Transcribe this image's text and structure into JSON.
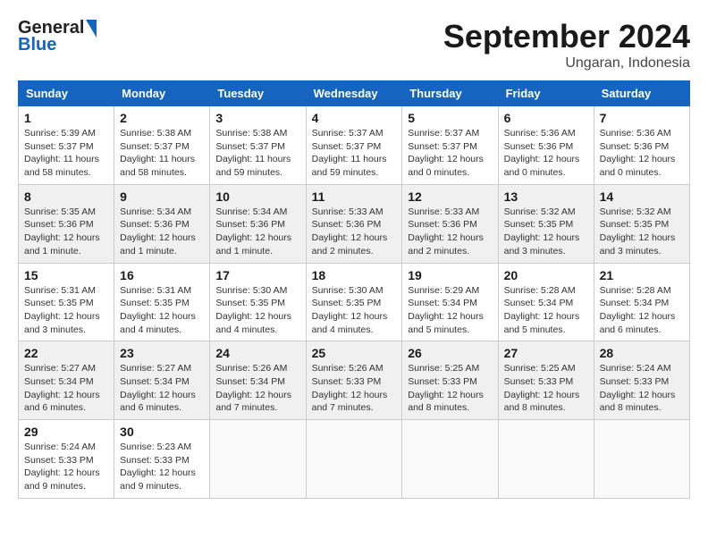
{
  "header": {
    "logo_general": "General",
    "logo_blue": "Blue",
    "month": "September 2024",
    "location": "Ungaran, Indonesia"
  },
  "days_of_week": [
    "Sunday",
    "Monday",
    "Tuesday",
    "Wednesday",
    "Thursday",
    "Friday",
    "Saturday"
  ],
  "weeks": [
    [
      {
        "day": "1",
        "info": "Sunrise: 5:39 AM\nSunset: 5:37 PM\nDaylight: 11 hours\nand 58 minutes."
      },
      {
        "day": "2",
        "info": "Sunrise: 5:38 AM\nSunset: 5:37 PM\nDaylight: 11 hours\nand 58 minutes."
      },
      {
        "day": "3",
        "info": "Sunrise: 5:38 AM\nSunset: 5:37 PM\nDaylight: 11 hours\nand 59 minutes."
      },
      {
        "day": "4",
        "info": "Sunrise: 5:37 AM\nSunset: 5:37 PM\nDaylight: 11 hours\nand 59 minutes."
      },
      {
        "day": "5",
        "info": "Sunrise: 5:37 AM\nSunset: 5:37 PM\nDaylight: 12 hours\nand 0 minutes."
      },
      {
        "day": "6",
        "info": "Sunrise: 5:36 AM\nSunset: 5:36 PM\nDaylight: 12 hours\nand 0 minutes."
      },
      {
        "day": "7",
        "info": "Sunrise: 5:36 AM\nSunset: 5:36 PM\nDaylight: 12 hours\nand 0 minutes."
      }
    ],
    [
      {
        "day": "8",
        "info": "Sunrise: 5:35 AM\nSunset: 5:36 PM\nDaylight: 12 hours\nand 1 minute."
      },
      {
        "day": "9",
        "info": "Sunrise: 5:34 AM\nSunset: 5:36 PM\nDaylight: 12 hours\nand 1 minute."
      },
      {
        "day": "10",
        "info": "Sunrise: 5:34 AM\nSunset: 5:36 PM\nDaylight: 12 hours\nand 1 minute."
      },
      {
        "day": "11",
        "info": "Sunrise: 5:33 AM\nSunset: 5:36 PM\nDaylight: 12 hours\nand 2 minutes."
      },
      {
        "day": "12",
        "info": "Sunrise: 5:33 AM\nSunset: 5:36 PM\nDaylight: 12 hours\nand 2 minutes."
      },
      {
        "day": "13",
        "info": "Sunrise: 5:32 AM\nSunset: 5:35 PM\nDaylight: 12 hours\nand 3 minutes."
      },
      {
        "day": "14",
        "info": "Sunrise: 5:32 AM\nSunset: 5:35 PM\nDaylight: 12 hours\nand 3 minutes."
      }
    ],
    [
      {
        "day": "15",
        "info": "Sunrise: 5:31 AM\nSunset: 5:35 PM\nDaylight: 12 hours\nand 3 minutes."
      },
      {
        "day": "16",
        "info": "Sunrise: 5:31 AM\nSunset: 5:35 PM\nDaylight: 12 hours\nand 4 minutes."
      },
      {
        "day": "17",
        "info": "Sunrise: 5:30 AM\nSunset: 5:35 PM\nDaylight: 12 hours\nand 4 minutes."
      },
      {
        "day": "18",
        "info": "Sunrise: 5:30 AM\nSunset: 5:35 PM\nDaylight: 12 hours\nand 4 minutes."
      },
      {
        "day": "19",
        "info": "Sunrise: 5:29 AM\nSunset: 5:34 PM\nDaylight: 12 hours\nand 5 minutes."
      },
      {
        "day": "20",
        "info": "Sunrise: 5:28 AM\nSunset: 5:34 PM\nDaylight: 12 hours\nand 5 minutes."
      },
      {
        "day": "21",
        "info": "Sunrise: 5:28 AM\nSunset: 5:34 PM\nDaylight: 12 hours\nand 6 minutes."
      }
    ],
    [
      {
        "day": "22",
        "info": "Sunrise: 5:27 AM\nSunset: 5:34 PM\nDaylight: 12 hours\nand 6 minutes."
      },
      {
        "day": "23",
        "info": "Sunrise: 5:27 AM\nSunset: 5:34 PM\nDaylight: 12 hours\nand 6 minutes."
      },
      {
        "day": "24",
        "info": "Sunrise: 5:26 AM\nSunset: 5:34 PM\nDaylight: 12 hours\nand 7 minutes."
      },
      {
        "day": "25",
        "info": "Sunrise: 5:26 AM\nSunset: 5:33 PM\nDaylight: 12 hours\nand 7 minutes."
      },
      {
        "day": "26",
        "info": "Sunrise: 5:25 AM\nSunset: 5:33 PM\nDaylight: 12 hours\nand 8 minutes."
      },
      {
        "day": "27",
        "info": "Sunrise: 5:25 AM\nSunset: 5:33 PM\nDaylight: 12 hours\nand 8 minutes."
      },
      {
        "day": "28",
        "info": "Sunrise: 5:24 AM\nSunset: 5:33 PM\nDaylight: 12 hours\nand 8 minutes."
      }
    ],
    [
      {
        "day": "29",
        "info": "Sunrise: 5:24 AM\nSunset: 5:33 PM\nDaylight: 12 hours\nand 9 minutes."
      },
      {
        "day": "30",
        "info": "Sunrise: 5:23 AM\nSunset: 5:33 PM\nDaylight: 12 hours\nand 9 minutes."
      },
      {
        "day": "",
        "info": ""
      },
      {
        "day": "",
        "info": ""
      },
      {
        "day": "",
        "info": ""
      },
      {
        "day": "",
        "info": ""
      },
      {
        "day": "",
        "info": ""
      }
    ]
  ]
}
